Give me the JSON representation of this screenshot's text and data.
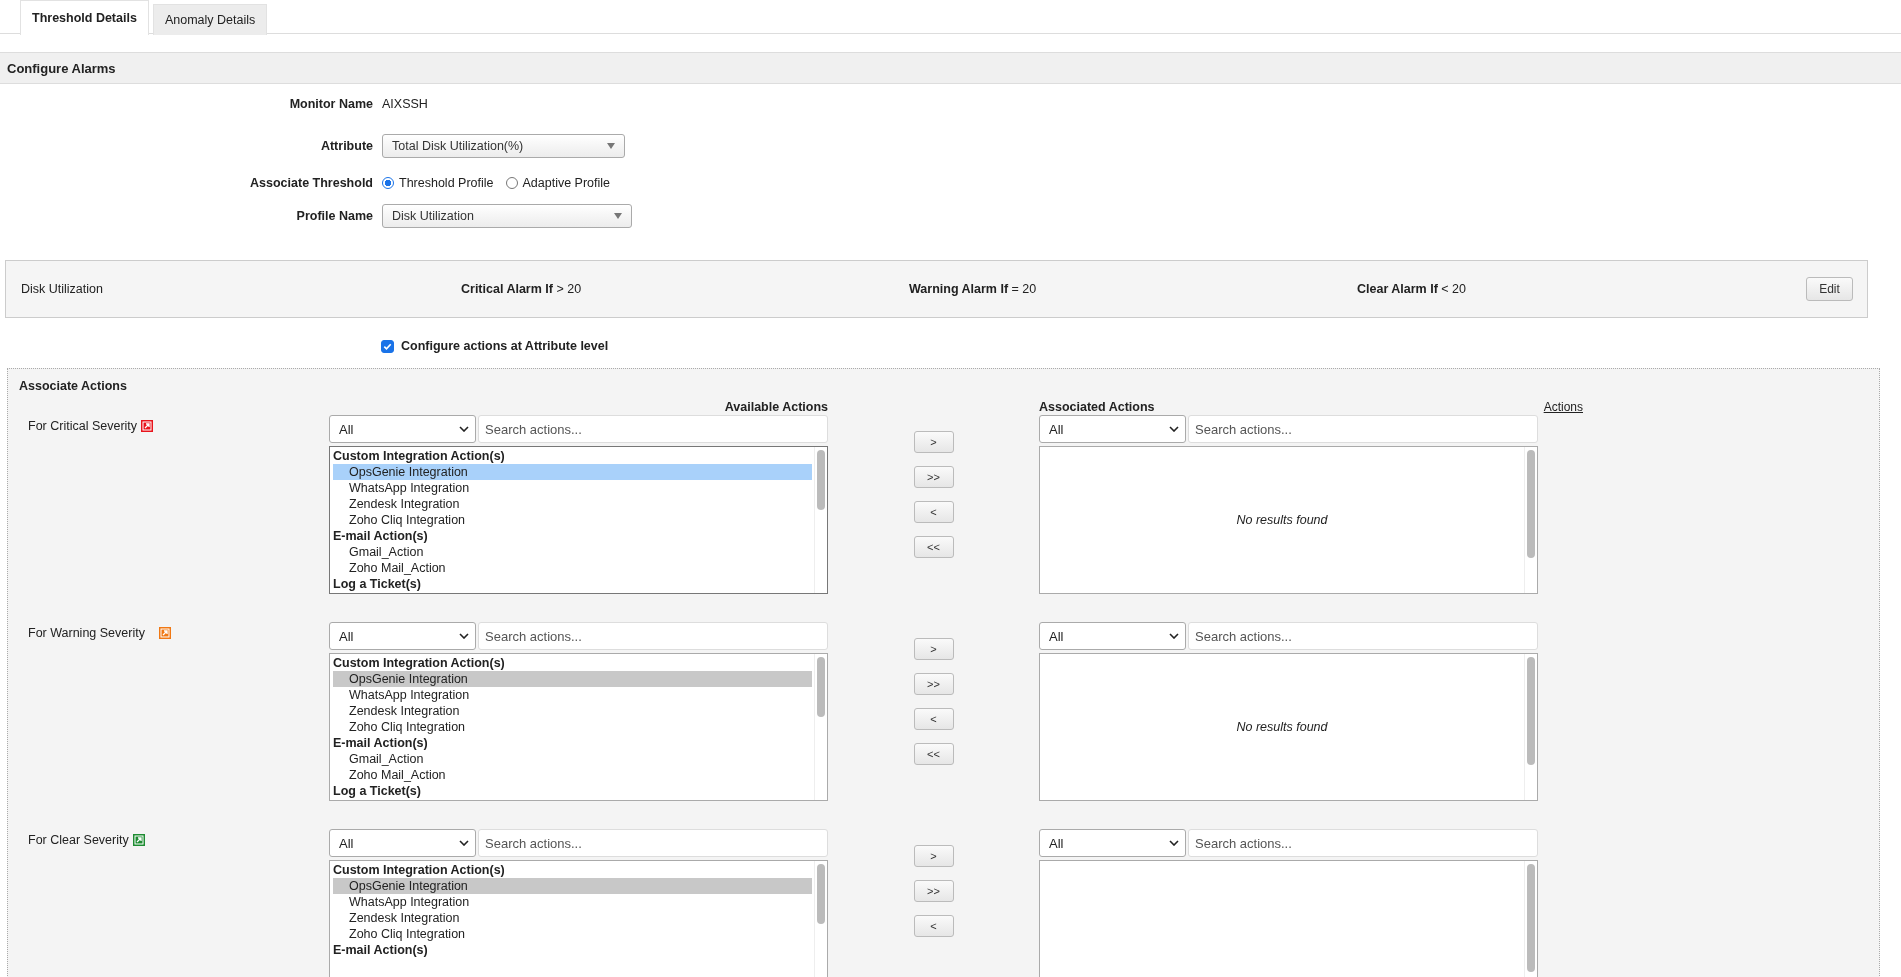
{
  "tabs": [
    {
      "label": "Threshold Details",
      "selected": true
    },
    {
      "label": "Anomaly Details",
      "selected": false
    }
  ],
  "section_title": "Configure Alarms",
  "form": {
    "monitor_name": {
      "label": "Monitor Name",
      "value": "AIXSSH"
    },
    "attribute": {
      "label": "Attribute",
      "value": "Total Disk Utilization(%)"
    },
    "associate_threshold": {
      "label": "Associate Threshold",
      "options": [
        {
          "label": "Threshold Profile",
          "selected": true
        },
        {
          "label": "Adaptive Profile",
          "selected": false
        }
      ]
    },
    "profile_name": {
      "label": "Profile Name",
      "value": "Disk Utilization"
    }
  },
  "profile_bar": {
    "name": "Disk Utilization",
    "conditions": [
      {
        "label": "Critical Alarm If",
        "value": "> 20"
      },
      {
        "label": "Warning Alarm If",
        "value": "= 20"
      },
      {
        "label": "Clear Alarm If",
        "value": "< 20"
      }
    ],
    "edit_button": "Edit"
  },
  "attribute_level": {
    "label": "Configure actions at Attribute level",
    "checked": true
  },
  "associate_actions": {
    "title": "Associate Actions",
    "available_heading": "Available Actions",
    "associated_heading": "Associated Actions",
    "actions_link": "Actions",
    "severities": [
      {
        "label": "For Critical Severity",
        "color": "#e8141c",
        "focused": true,
        "filter": "All",
        "search_placeholder": "Search actions...",
        "assoc_filter": "All",
        "assoc_search_placeholder": "Search actions...",
        "empty_text": "No results found",
        "buttons": [
          ">",
          ">>",
          "<",
          "<<"
        ],
        "groups": [
          {
            "name": "Custom Integration Action(s)",
            "items": [
              {
                "label": "OpsGenie Integration",
                "selected": true
              },
              {
                "label": "WhatsApp Integration",
                "selected": false
              },
              {
                "label": "Zendesk Integration",
                "selected": false
              },
              {
                "label": "Zoho Cliq Integration",
                "selected": false
              }
            ]
          },
          {
            "name": "E-mail Action(s)",
            "items": [
              {
                "label": "Gmail_Action",
                "selected": false
              },
              {
                "label": "Zoho Mail_Action",
                "selected": false
              }
            ]
          },
          {
            "name": "Log a Ticket(s)"
          }
        ]
      },
      {
        "label": "For Warning Severity",
        "color": "#f07814",
        "focused": false,
        "filter": "All",
        "search_placeholder": "Search actions...",
        "assoc_filter": "All",
        "assoc_search_placeholder": "Search actions...",
        "empty_text": "No results found",
        "buttons": [
          ">",
          ">>",
          "<",
          "<<"
        ],
        "groups": [
          {
            "name": "Custom Integration Action(s)",
            "items": [
              {
                "label": "OpsGenie Integration",
                "selected": true
              },
              {
                "label": "WhatsApp Integration",
                "selected": false
              },
              {
                "label": "Zendesk Integration",
                "selected": false
              },
              {
                "label": "Zoho Cliq Integration",
                "selected": false
              }
            ]
          },
          {
            "name": "E-mail Action(s)",
            "items": [
              {
                "label": "Gmail_Action",
                "selected": false
              },
              {
                "label": "Zoho Mail_Action",
                "selected": false
              }
            ]
          },
          {
            "name": "Log a Ticket(s)"
          }
        ]
      },
      {
        "label": "For Clear Severity",
        "color": "#1e8c32",
        "focused": false,
        "filter": "All",
        "search_placeholder": "Search actions...",
        "assoc_filter": "All",
        "assoc_search_placeholder": "Search actions...",
        "buttons": [
          ">",
          ">>",
          "<"
        ],
        "groups": [
          {
            "name": "Custom Integration Action(s)",
            "items": [
              {
                "label": "OpsGenie Integration",
                "selected": true
              },
              {
                "label": "WhatsApp Integration",
                "selected": false
              },
              {
                "label": "Zendesk Integration",
                "selected": false
              },
              {
                "label": "Zoho Cliq Integration",
                "selected": false
              }
            ]
          },
          {
            "name": "E-mail Action(s)"
          }
        ]
      }
    ]
  }
}
